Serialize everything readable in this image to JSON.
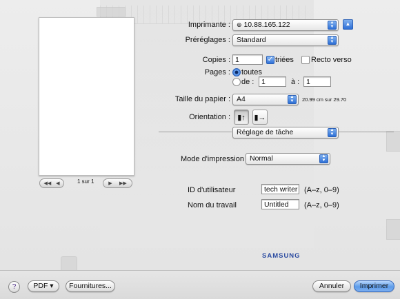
{
  "printer": {
    "label": "Imprimante :",
    "value": "10.88.165.122",
    "icon": "network-printer-icon",
    "collapse_icon": "disclosure-up-icon"
  },
  "presets": {
    "label": "Préréglages :",
    "value": "Standard"
  },
  "copies": {
    "label": "Copies :",
    "value": "1",
    "collated_label": "triées",
    "collated": true,
    "duplex_label": "Recto verso",
    "duplex": false
  },
  "pages": {
    "label": "Pages :",
    "all_label": "toutes",
    "all_selected": true,
    "from_label": "de :",
    "from_value": "1",
    "to_label": "à :",
    "to_value": "1"
  },
  "paper": {
    "label": "Taille du papier :",
    "value": "A4",
    "dimensions": "20.99 cm sur 29.70"
  },
  "orientation": {
    "label": "Orientation :",
    "options": [
      "portrait-icon",
      "landscape-icon"
    ],
    "selected": "portrait-icon"
  },
  "panel_select": {
    "value": "Réglage de tâche"
  },
  "print_mode": {
    "label": "Mode d'impression",
    "value": "Normal"
  },
  "user_id": {
    "label": "ID d'utilisateur",
    "value": "tech writer",
    "hint": "(A–z, 0–9)"
  },
  "job_name": {
    "label": "Nom du travail",
    "value": "Untitled",
    "hint": "(A–z, 0–9)"
  },
  "preview_nav": {
    "page_text": "1 sur 1",
    "first_prev": [
      "◀◀",
      "◀"
    ],
    "next_last": [
      "▶",
      "▶▶"
    ]
  },
  "brand": "SAMSUNG",
  "footer": {
    "help": "?",
    "pdf": "PDF ▾",
    "supplies": "Fournitures...",
    "cancel": "Annuler",
    "print": "Imprimer"
  },
  "colors": {
    "accent": "#2d6fd6",
    "default_button": "#5c9be9",
    "brand": "#2a4aa0"
  }
}
